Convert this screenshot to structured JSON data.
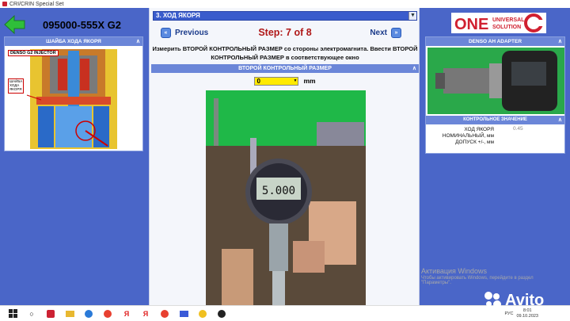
{
  "window": {
    "title": "CRI/CRIN Special Set"
  },
  "header": {
    "part_number": "095000-555X  G2"
  },
  "left_card": {
    "title": "ШАЙБА ХОДА ЯКОРЯ",
    "injector_label": "DENSO G2 INJECTOR",
    "callout": "ШАЙБА ХОДА ЯКОРЯ"
  },
  "step": {
    "selected": "3. ХОД ЯКОРЯ",
    "previous_label": "Previous",
    "next_label": "Next",
    "counter": "Step: 7 of 8",
    "instruction": "Измерить ВТОРОЙ КОНТРОЛЬНЫЙ РАЗМЕР со стороны электромагнита. Ввести ВТОРОЙ КОНТРОЛЬНЫЙ РАЗМЕР в соответствующее окно",
    "section_title": "ВТОРОЙ КОНТРОЛЬНЫЙ РАЗМЕР",
    "value": "0",
    "unit": "mm",
    "gauge_reading": "5.000"
  },
  "right_card": {
    "logo_main": "ONE",
    "logo_sub1": "UNIVERSAL",
    "logo_sub2": "SOLUTION",
    "adapter_title": "DENSO AH ADAPTER",
    "control_title": "КОНТРОЛЬНОЕ ЗНАЧЕНИЕ",
    "labels": [
      "ХОД ЯКОРЯ",
      "НОМИНАЛЬНЫЙ, мм",
      "ДОПУСК +/-, мм"
    ],
    "values": [
      "0.45",
      ""
    ]
  },
  "watermark": {
    "line1": "Активация Windows",
    "line2": "Чтобы активировать Windows, перейдите в раздел",
    "line3": "\"Параметры\"."
  },
  "taskbar": {
    "lang": "РУС",
    "time": "8:01",
    "date": "09.10.2023"
  },
  "overlay": {
    "avito": "Avito"
  },
  "colors": {
    "panel_blue": "#4a66c8",
    "header_blue": "#6b86d8",
    "step_red": "#b01818",
    "input_yellow": "#ffea00"
  }
}
